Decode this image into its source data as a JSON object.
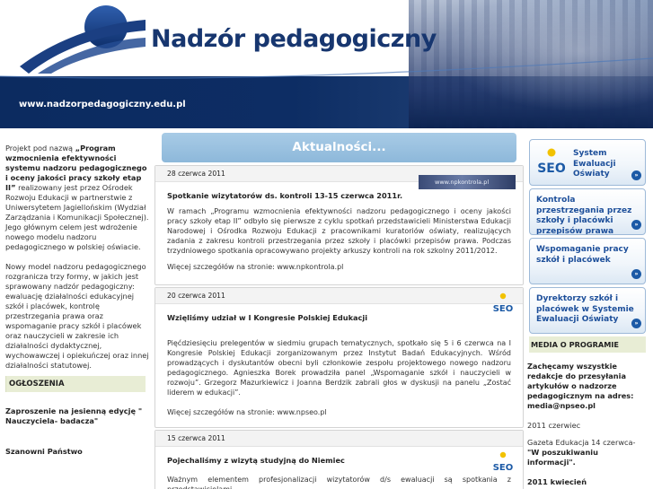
{
  "header": {
    "title": "Nadzór pedagogiczny",
    "url": "www.nadzorpedagogiczny.edu.pl"
  },
  "left": {
    "intro_prefix": "Projekt pod nazwą ",
    "intro_bold": "„Program wzmocnienia efektywności systemu nadzoru pedagogicznego i oceny jakości pracy szkoły etap II”",
    "intro_rest": " realizowany jest przez Ośrodek Rozwoju Edukacji w partnerstwie z Uniwersytetem Jagiellońskim (Wydział Zarządzania i Komunikacji Społecznej). Jego głównym celem jest wdrożenie nowego modelu nadzoru pedagogicznego w polskiej oświacie.",
    "paragraph2": "Nowy model nadzoru pedagogicznego rozgranicza trzy formy, w jakich jest sprawowany nadzór pedagogiczny: ewaluację działalności edukacyjnej szkół i placówek, kontrolę przestrzegania prawa oraz wspomaganie pracy szkół i placówek oraz nauczycieli w zakresie ich działalności dydaktycznej, wychowawczej i opiekuńczej oraz innej działalności statutowej.",
    "section_heading": "OGŁOSZENIA",
    "announcement": "Zaproszenie na jesienną edycję \" Nauczyciela- badacza\"",
    "cut_text": "Szanowni Państwo"
  },
  "center": {
    "heading": "Aktualności...",
    "items": [
      {
        "date": "28 czerwca 2011",
        "title": "Spotkanie wizytatorów ds. kontroli 13-15 czerwca 2011r.",
        "body": "W ramach „Programu wzmocnienia efektywności nadzoru pedagogicznego i oceny jakości pracy szkoły etap II” odbyło się pierwsze z cyklu spotkań przedstawicieli Ministerstwa Edukacji Narodowej i Ośrodka Rozwoju Edukacji z pracownikami kuratoriów oświaty, realizujących zadania z zakresu kontroli przestrzegania przez szkoły i placówki przepisów prawa. Podczas trzydniowego spotkania opracowywano projekty arkuszy kontroli na rok szkolny 2011/2012.",
        "more": "Więcej szczegółów na stronie: www.npkontrola.pl",
        "thumb": "www.npkontrola.pl"
      },
      {
        "date": "20 czerwca 2011",
        "title": "Wzięliśmy udział w I Kongresie Polskiej Edukacji",
        "body": "Pięćdziesięciu prelegentów w siedmiu grupach tematycznych, spotkało się 5 i 6 czerwca na I Kongresie Polskiej Edukacji zorganizowanym przez Instytut Badań Edukacyjnych. Wśród prowadzących i dyskutantów obecni byli członkowie zespołu projektowego nowego nadzoru pedagogicznego. Agnieszka Borek prowadziła panel „Wspomaganie szkół i nauczycieli w rozwoju”. Grzegorz Mazurkiewicz i Joanna Berdzik zabrali głos w dyskusji na panelu „Zostać liderem w edukacji”.",
        "more": "Więcej szczegółów na stronie: www.npseo.pl",
        "thumb": "SEO"
      },
      {
        "date": "15 czerwca 2011",
        "title": "Pojechaliśmy z wizytą studyjną do Niemiec",
        "body": "Ważnym elementem profesjonalizacji wizytatorów d/s ewaluacji są spotkania z przedstawicielami",
        "more": "",
        "thumb": "SEO"
      }
    ]
  },
  "right": {
    "buttons": [
      {
        "label": "System Ewaluacji Oświaty",
        "logo": "SEO"
      },
      {
        "label": "Kontrola przestrzegania przez szkoły i placówki przepisów prawa"
      },
      {
        "label": "Wspomaganie pracy szkół i placówek"
      },
      {
        "label": "Dyrektorzy szkół i placówek w Systemie Ewaluacji Oświaty"
      }
    ],
    "arrow": "»",
    "media_heading": "MEDIA O PROGRAMIE",
    "media_intro": "Zachęcamy wszystkie redakcje do przesyłania artykułów o nadzorze pedagogicznym na adres: media@npseo.pl",
    "month1": "2011 czerwiec",
    "article1_prefix": "Gazeta Edukacja 14 czerwca- ",
    "article1_bold": "\"W poszukiwaniu informacji\".",
    "month2": "2011 kwiecień"
  },
  "colors": {
    "brand_blue": "#17366f",
    "header_navy": "#0c2b60",
    "tab_blue": "#9cc2e1",
    "button_text": "#1d4f9a",
    "section_bg": "#e8edd5"
  }
}
